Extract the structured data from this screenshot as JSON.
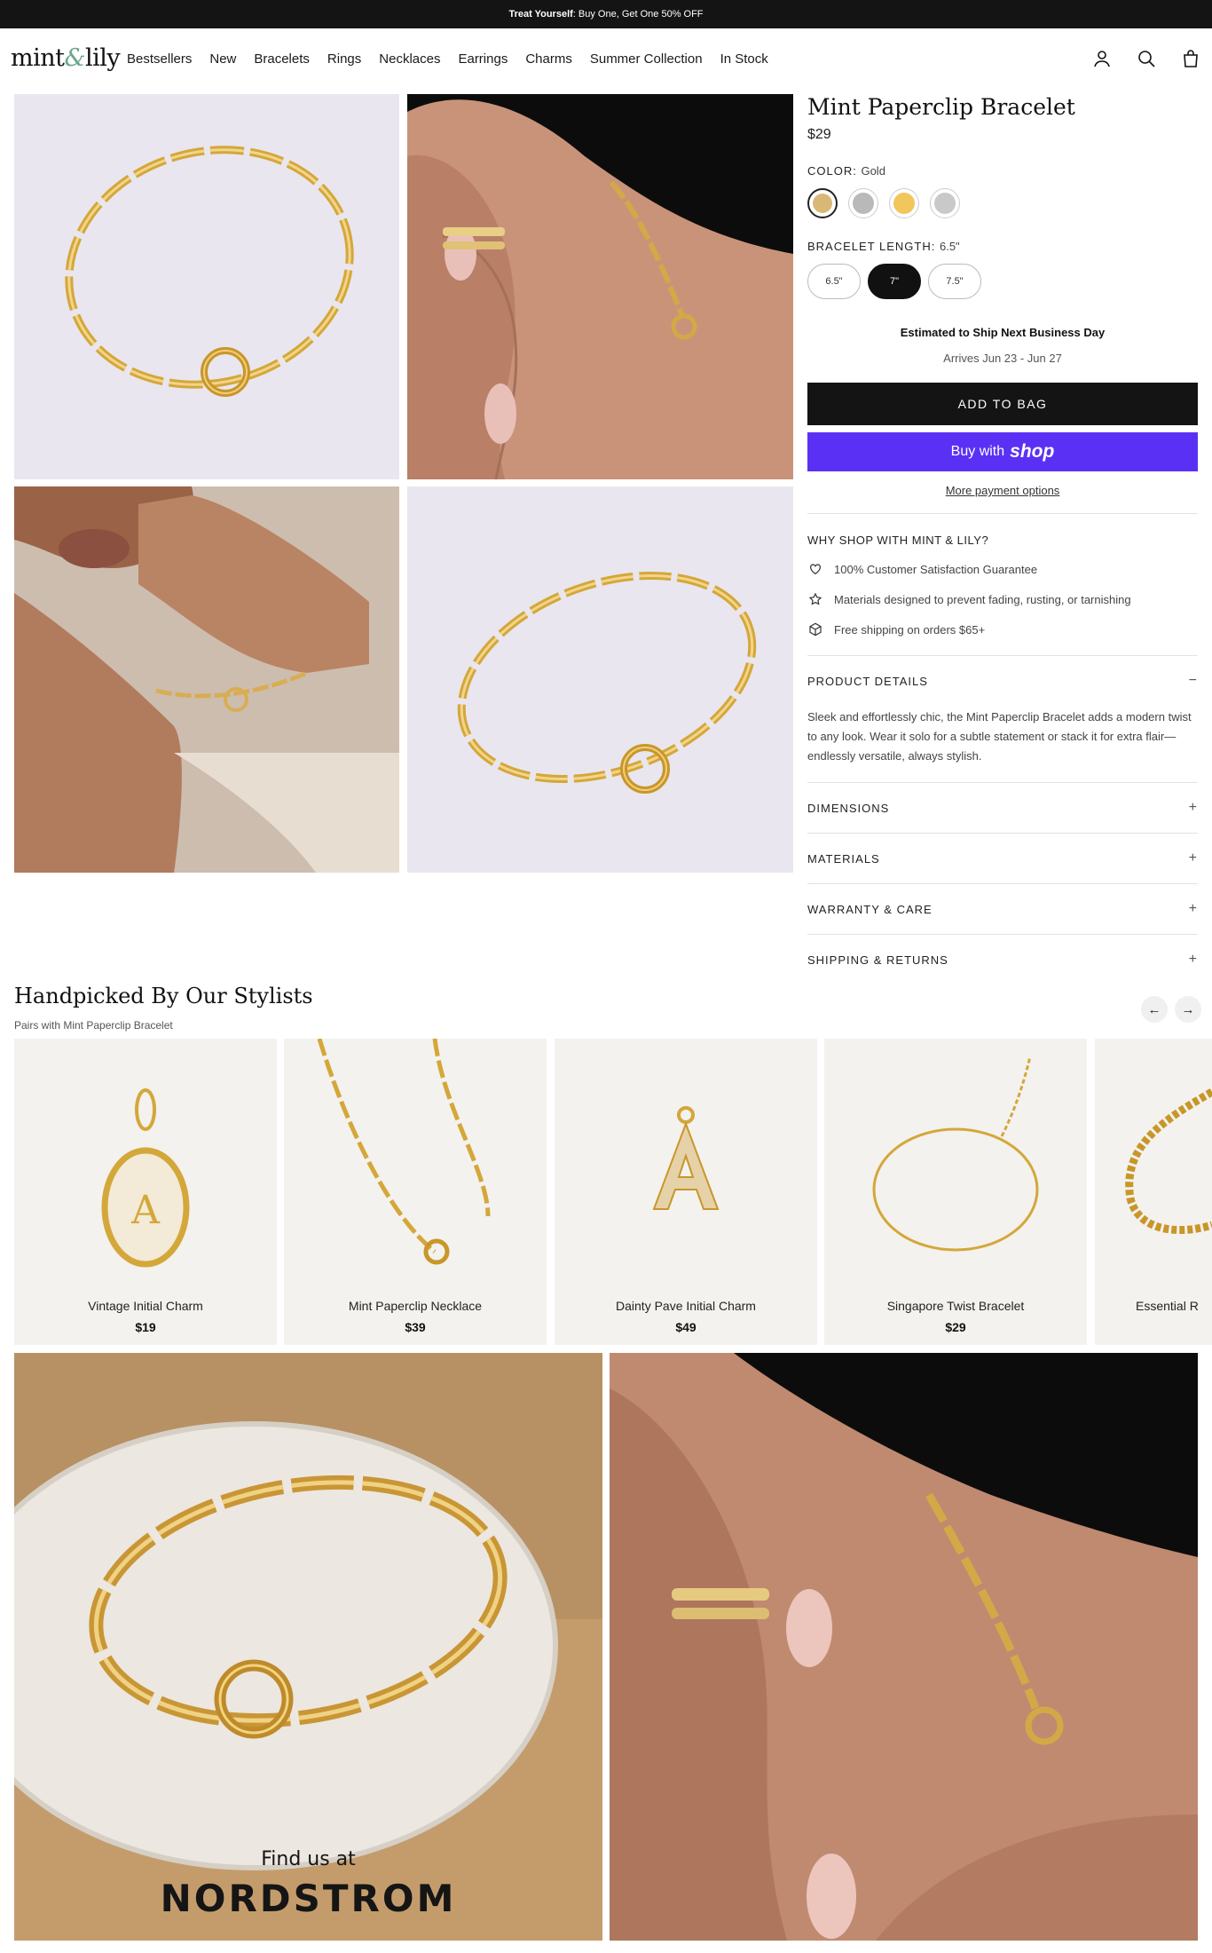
{
  "announcement": {
    "bold": "Treat Yourself",
    "rest": ": Buy One, Get One 50% OFF"
  },
  "header": {
    "logo_left": "mint",
    "logo_amp": "&",
    "logo_right": "lily",
    "nav": [
      "Bestsellers",
      "New",
      "Bracelets",
      "Rings",
      "Necklaces",
      "Earrings",
      "Charms",
      "Summer Collection",
      "In Stock"
    ]
  },
  "product": {
    "title": "Mint Paperclip Bracelet",
    "price": "$29",
    "color_label": "COLOR:",
    "color_value": "Gold",
    "swatch_colors": [
      "#d9b877",
      "#b9b9b9",
      "#f1c65a",
      "#c9c9c9"
    ],
    "length_label": "BRACELET LENGTH:",
    "length_value": "6.5\"",
    "sizes": [
      "6.5\"",
      "7\"",
      "7.5\""
    ],
    "selected_size_index": 1,
    "ship_text": "Estimated to Ship Next Business Day",
    "arrive_text": "Arrives Jun 23 - Jun 27",
    "add_to_bag": "ADD TO BAG",
    "buy_with": "Buy with",
    "shop_word": "shop",
    "more_payment": "More payment options",
    "why_title": "WHY SHOP WITH MINT & LILY?",
    "features": [
      {
        "icon": "heart-icon",
        "text": "100% Customer Satisfaction Guarantee"
      },
      {
        "icon": "star-icon",
        "text": "Materials designed to prevent fading, rusting, or tarnishing"
      },
      {
        "icon": "box-icon",
        "text": "Free shipping on orders $65+"
      }
    ],
    "details_title": "PRODUCT DETAILS",
    "details_text": "Sleek and effortlessly chic, the Mint Paperclip Bracelet adds a modern twist to any look. Wear it solo for a subtle statement or stack it for extra flair—endlessly versatile, always stylish.",
    "accordions": [
      "DIMENSIONS",
      "MATERIALS",
      "WARRANTY & CARE",
      "SHIPPING & RETURNS"
    ]
  },
  "handpicked": {
    "title": "Handpicked By Our Stylists",
    "subtitle": "Pairs with Mint Paperclip Bracelet",
    "prev": "←",
    "next": "→",
    "items": [
      {
        "name": "Vintage Initial Charm",
        "price": "$19"
      },
      {
        "name": "Mint Paperclip Necklace",
        "price": "$39"
      },
      {
        "name": "Dainty Pave Initial Charm",
        "price": "$49"
      },
      {
        "name": "Singapore Twist Bracelet",
        "price": "$29"
      },
      {
        "name": "Essential R",
        "price": ""
      }
    ]
  },
  "promo": {
    "find_us": "Find us at",
    "store": "NORDSTROM"
  }
}
